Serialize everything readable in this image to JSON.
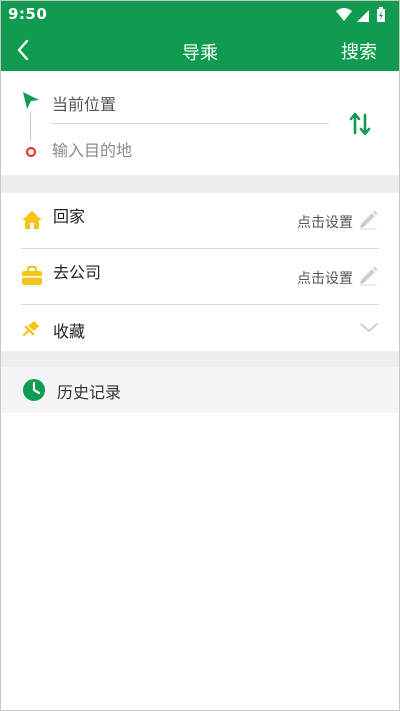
{
  "status_bar": {
    "time": "9:50"
  },
  "app_bar": {
    "title": "导乘",
    "search_label": "搜索"
  },
  "route": {
    "start_value": "当前位置",
    "end_placeholder": "输入目的地"
  },
  "shortcuts": [
    {
      "label": "回家",
      "action": "点击设置",
      "icon": "home-icon"
    },
    {
      "label": "去公司",
      "action": "点击设置",
      "icon": "briefcase-icon"
    },
    {
      "label": "收藏",
      "icon": "pin-icon"
    }
  ],
  "history": {
    "label": "历史记录",
    "icon": "clock-icon"
  },
  "colors": {
    "primary": "#109b50",
    "home_yellow": "#f5c518",
    "end_red": "#e03c31"
  }
}
